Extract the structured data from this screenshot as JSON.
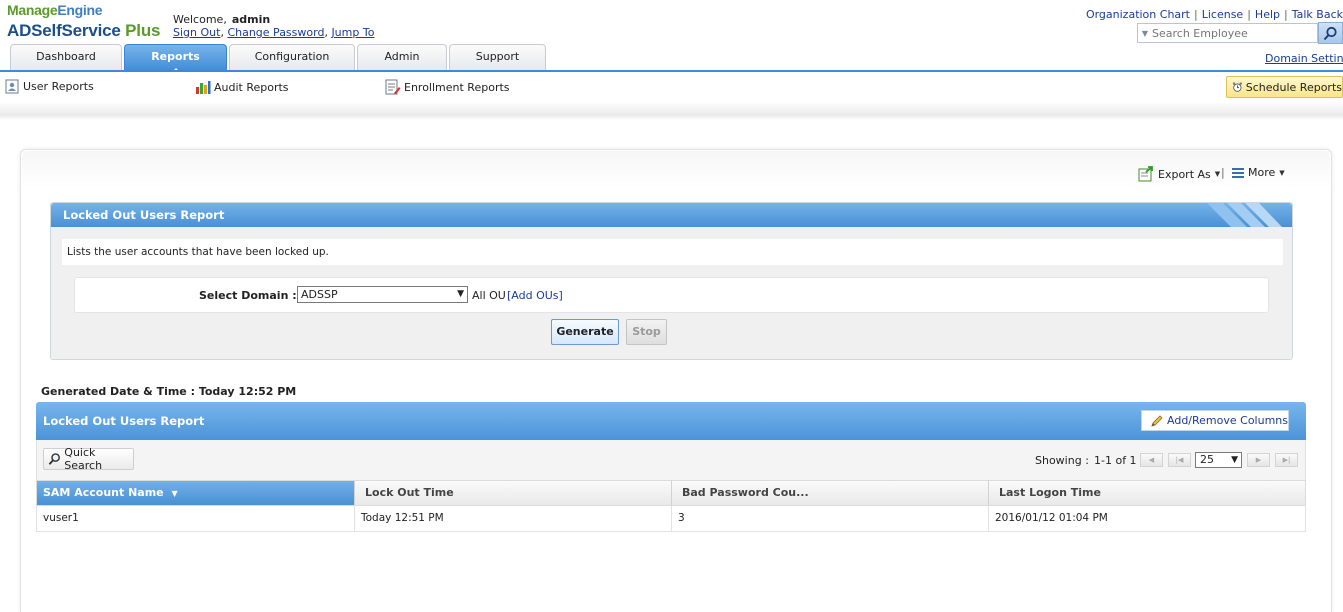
{
  "brand": {
    "top_a": "Manage",
    "top_b": "Engine",
    "product": "ADSelfService",
    "product_suffix": "Plus"
  },
  "user": {
    "welcome_label": "Welcome,",
    "name": "admin",
    "links": [
      "Sign Out",
      "Change Password",
      "Jump To"
    ]
  },
  "top_links": [
    "Organization Chart",
    "License",
    "Help",
    "Talk Back"
  ],
  "search": {
    "placeholder": "Search Employee"
  },
  "domain_settings": "Domain Settings",
  "tabs": [
    {
      "label": "Dashboard",
      "active": false
    },
    {
      "label": "Reports",
      "active": true
    },
    {
      "label": "Configuration",
      "active": false
    },
    {
      "label": "Admin",
      "active": false
    },
    {
      "label": "Support",
      "active": false
    }
  ],
  "subnav": {
    "items": [
      "User Reports",
      "Audit Reports",
      "Enrollment Reports"
    ],
    "schedule": "Schedule Reports"
  },
  "actions": {
    "export": "Export As",
    "sep": "|",
    "more": "More"
  },
  "criteria": {
    "title": "Locked Out Users Report",
    "description": "Lists the user accounts that have been locked up.",
    "select_label": "Select Domain :",
    "domain_value": "ADSSP",
    "ou_text": "All OU",
    "add_ous": "[Add OUs]",
    "generate": "Generate",
    "stop": "Stop"
  },
  "generated": "Generated Date & Time : Today 12:52 PM",
  "results": {
    "title": "Locked Out Users Report",
    "add_remove": "Add/Remove Columns",
    "quick_search": "Quick Search",
    "showing_label": "Showing :",
    "range": "1-1 of 1",
    "per_page": "25",
    "columns": [
      "SAM Account Name",
      "Lock Out Time",
      "Bad Password Cou...",
      "Last Logon Time"
    ],
    "rows": [
      [
        "vuser1",
        "Today 12:51 PM",
        "3",
        "2016/01/12 01:04 PM"
      ]
    ]
  },
  "colors": {
    "accent_blue": "#4a90d4",
    "link_blue": "#1a3b9a",
    "brand_green": "#5a9a2a",
    "schedule_yellow": "#f7e68a"
  }
}
